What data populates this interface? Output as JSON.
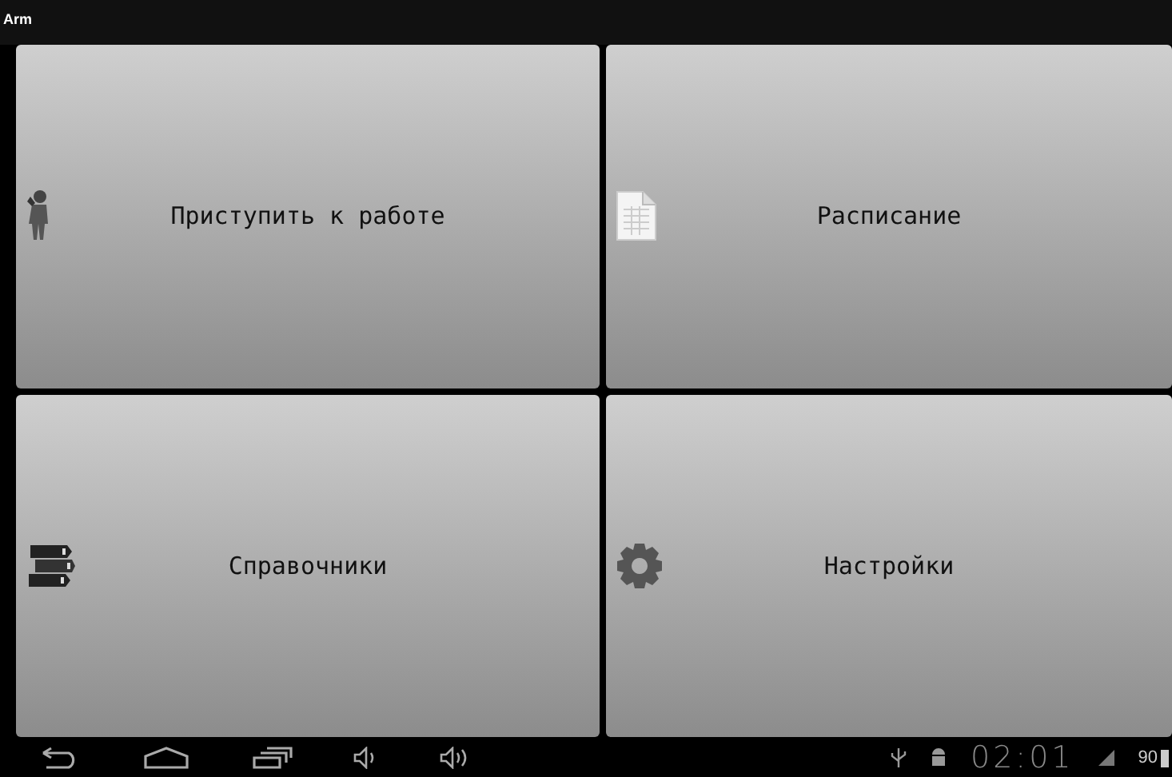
{
  "window": {
    "title": "Arm"
  },
  "tiles": [
    {
      "kind": "person",
      "label": "Приступить к работе"
    },
    {
      "kind": "document",
      "label": "Расписание"
    },
    {
      "kind": "books",
      "label": "Справочники"
    },
    {
      "kind": "gear",
      "label": "Настройки"
    }
  ],
  "status_bar": {
    "time": "02:01",
    "battery": "90"
  }
}
